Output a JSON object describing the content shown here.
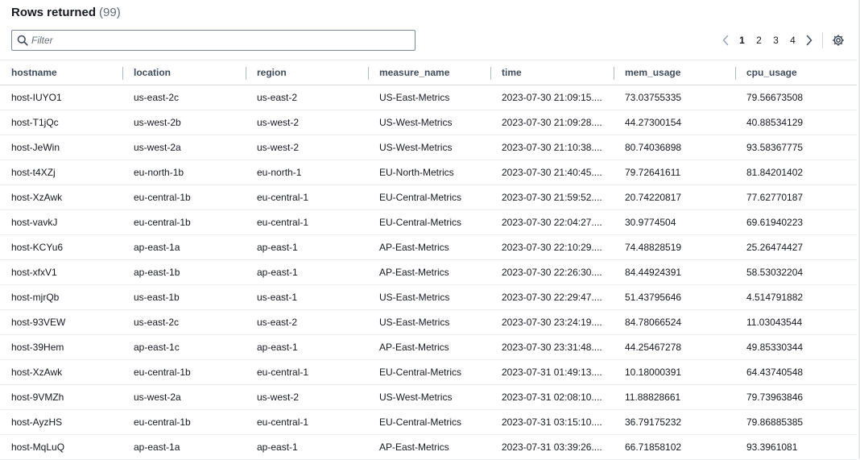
{
  "header": {
    "title": "Rows returned",
    "count": "(99)"
  },
  "filter": {
    "placeholder": "Filter",
    "value": ""
  },
  "pagination": {
    "pages": [
      "1",
      "2",
      "3",
      "4"
    ],
    "current": "1"
  },
  "table": {
    "columns": [
      "hostname",
      "location",
      "region",
      "measure_name",
      "time",
      "mem_usage",
      "cpu_usage"
    ],
    "rows": [
      [
        "host-IUYO1",
        "us-east-2c",
        "us-east-2",
        "US-East-Metrics",
        "2023-07-30 21:09:15....",
        "73.03755335",
        "79.56673508"
      ],
      [
        "host-T1jQc",
        "us-west-2b",
        "us-west-2",
        "US-West-Metrics",
        "2023-07-30 21:09:28....",
        "44.27300154",
        "40.88534129"
      ],
      [
        "host-JeWin",
        "us-west-2a",
        "us-west-2",
        "US-West-Metrics",
        "2023-07-30 21:10:38....",
        "80.74036898",
        "93.58367775"
      ],
      [
        "host-t4XZj",
        "eu-north-1b",
        "eu-north-1",
        "EU-North-Metrics",
        "2023-07-30 21:40:45....",
        "79.72641611",
        "81.84201402"
      ],
      [
        "host-XzAwk",
        "eu-central-1b",
        "eu-central-1",
        "EU-Central-Metrics",
        "2023-07-30 21:59:52....",
        "20.74220817",
        "77.62770187"
      ],
      [
        "host-vavkJ",
        "eu-central-1b",
        "eu-central-1",
        "EU-Central-Metrics",
        "2023-07-30 22:04:27....",
        "30.9774504",
        "69.61940223"
      ],
      [
        "host-KCYu6",
        "ap-east-1a",
        "ap-east-1",
        "AP-East-Metrics",
        "2023-07-30 22:10:29....",
        "74.48828519",
        "25.26474427"
      ],
      [
        "host-xfxV1",
        "ap-east-1b",
        "ap-east-1",
        "AP-East-Metrics",
        "2023-07-30 22:26:30....",
        "84.44924391",
        "58.53032204"
      ],
      [
        "host-mjrQb",
        "us-east-1b",
        "us-east-1",
        "US-East-Metrics",
        "2023-07-30 22:29:47....",
        "51.43795646",
        "4.514791882"
      ],
      [
        "host-93VEW",
        "us-east-2c",
        "us-east-2",
        "US-East-Metrics",
        "2023-07-30 23:24:19....",
        "84.78066524",
        "11.03043544"
      ],
      [
        "host-39Hem",
        "ap-east-1c",
        "ap-east-1",
        "AP-East-Metrics",
        "2023-07-30 23:31:48....",
        "44.25467278",
        "49.85330344"
      ],
      [
        "host-XzAwk",
        "eu-central-1b",
        "eu-central-1",
        "EU-Central-Metrics",
        "2023-07-31 01:49:13....",
        "10.18000391",
        "64.43740548"
      ],
      [
        "host-9VMZh",
        "us-west-2a",
        "us-west-2",
        "US-West-Metrics",
        "2023-07-31 02:08:10....",
        "11.88828661",
        "79.73963846"
      ],
      [
        "host-AyzHS",
        "eu-central-1b",
        "eu-central-1",
        "EU-Central-Metrics",
        "2023-07-31 03:15:10....",
        "36.79175232",
        "79.86885385"
      ],
      [
        "host-MqLuQ",
        "ap-east-1a",
        "ap-east-1",
        "AP-East-Metrics",
        "2023-07-31 03:39:26....",
        "66.71858102",
        "93.3961081"
      ]
    ]
  },
  "icons": {
    "search": "search-icon",
    "prev": "chevron-left-icon",
    "next": "chevron-right-icon",
    "settings": "gear-icon"
  },
  "colors": {
    "text": "#16191f",
    "muted": "#5f6b7a",
    "border": "#e9ebed",
    "disabled": "#9ba7b6"
  }
}
